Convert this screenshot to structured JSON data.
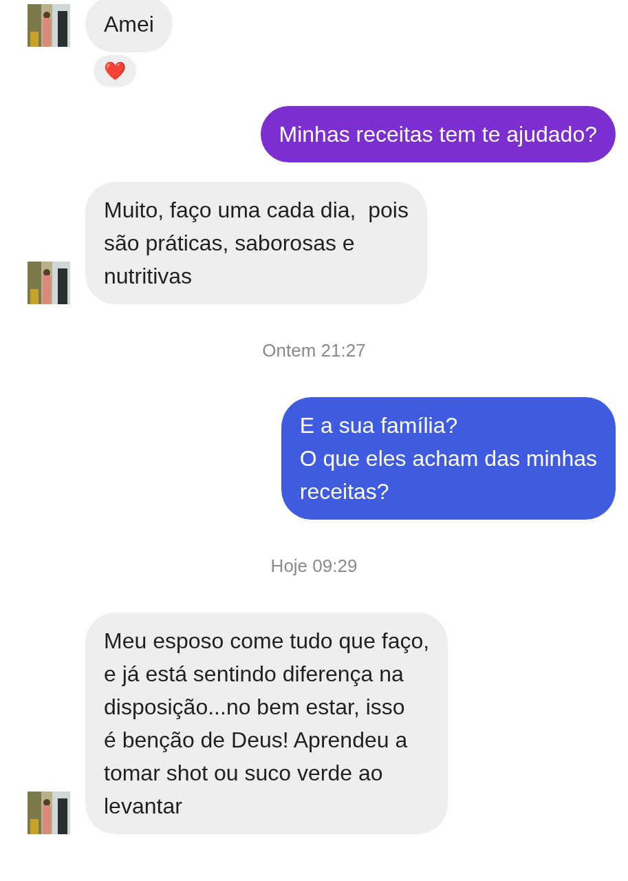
{
  "messages": [
    {
      "kind": "incoming",
      "text": "Amei",
      "avatar": true,
      "reaction": "❤️"
    },
    {
      "kind": "outgoing",
      "text": "Minhas receitas tem te ajudado?",
      "color": "#7b2fd0"
    },
    {
      "kind": "incoming",
      "text": "Muito, faço uma cada dia,  pois\nsão práticas, saborosas e\nnutritivas",
      "avatar": true
    },
    {
      "kind": "timestamp",
      "text": "Ontem 21:27"
    },
    {
      "kind": "outgoing",
      "text": "E a sua família?\nO que eles acham das minhas\nreceitas?",
      "color": "#3f5be0"
    },
    {
      "kind": "timestamp",
      "text": "Hoje 09:29"
    },
    {
      "kind": "incoming",
      "text": "Meu esposo come tudo que faço,\ne já está sentindo diferença na\ndisposição...no bem estar, isso\né benção de Deus! Aprendeu a\ntomar shot ou suco verde ao\nlevantar",
      "avatar": true
    }
  ]
}
